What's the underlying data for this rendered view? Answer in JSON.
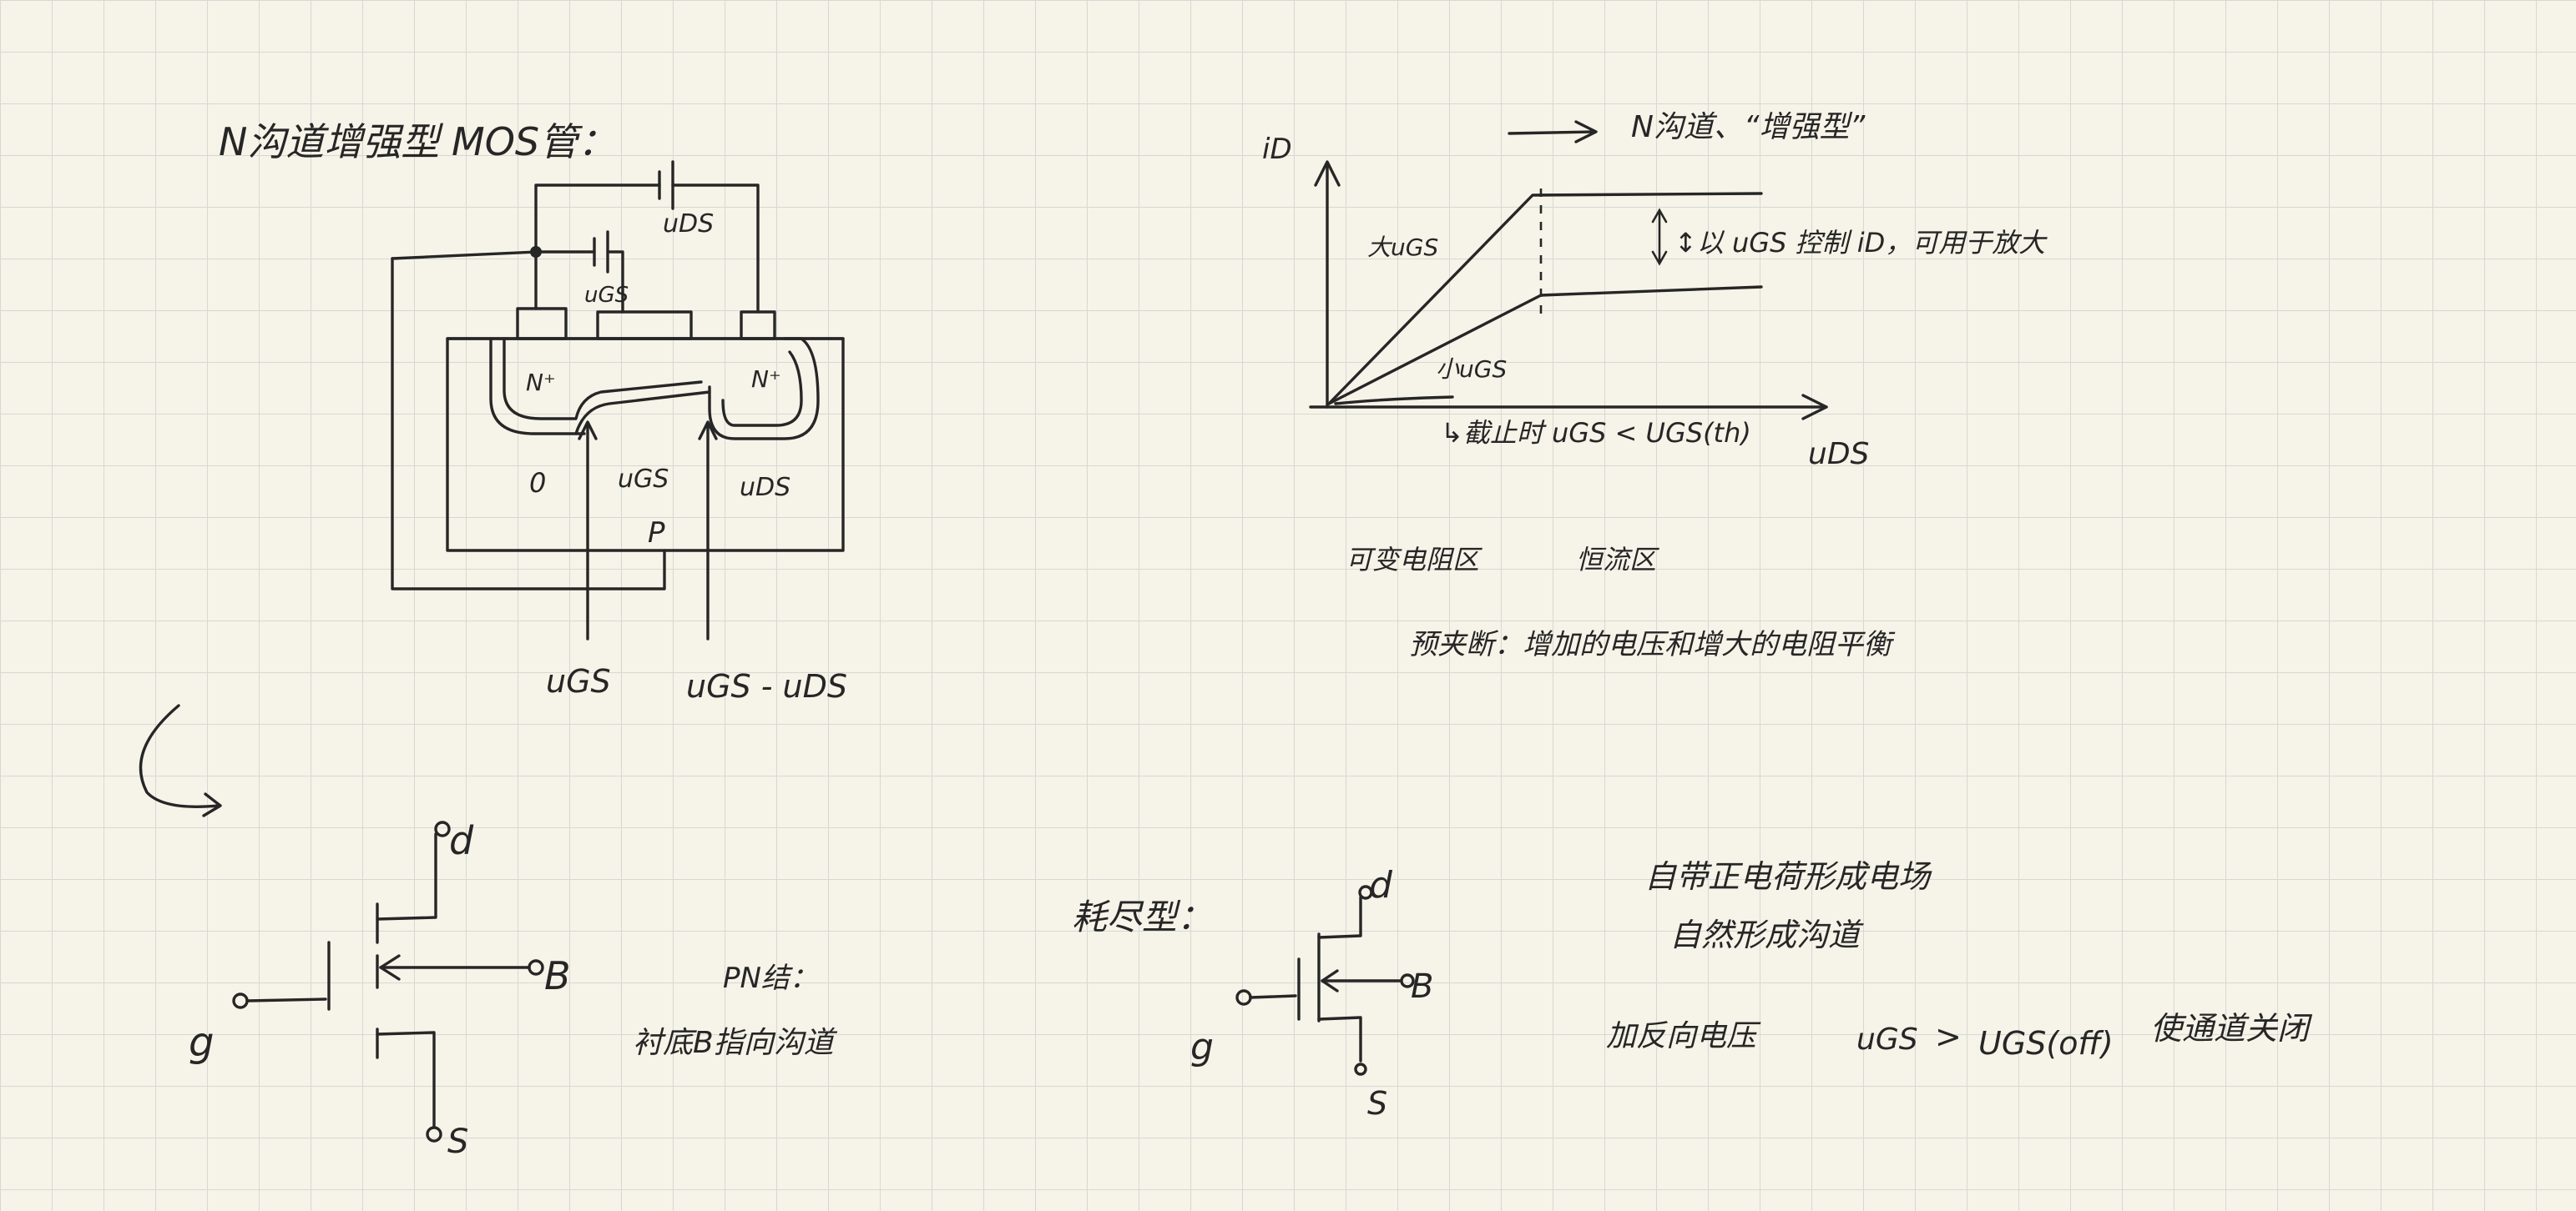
{
  "page": {
    "title": "N沟道增强型 MOS管："
  },
  "cross_section": {
    "labels": {
      "uds_top": "uDS",
      "ugs_top": "uGS",
      "n_left": "N⁺",
      "n_right": "N⁺",
      "zero": "0",
      "ugs_mid": "uGS",
      "uds_mid": "uDS",
      "p_substrate": "P",
      "ugs_bottom": "uGS",
      "ugs_minus_uds": "uGS - uDS"
    }
  },
  "characteristic": {
    "label_id": "iD",
    "arrow_note": "N沟道、“增强型”",
    "curve_large": "大uGS",
    "curve_small": "小uGS",
    "control_note": "↕以 uGS 控制 iD，可用于放大",
    "cutoff_note": "↳截止时 uGS < UGS(th)",
    "label_uds": "uDS",
    "region_variable": "可变电阻区",
    "region_constant": "恒流区",
    "pinchoff_note": "预夹断：增加的电压和增大的电阻平衡"
  },
  "enh_symbol": {
    "d": "d",
    "g": "g",
    "b": "B",
    "s": "S",
    "pn_note": "PN结：",
    "sub_note": "衬底B指向沟道"
  },
  "dep_symbol": {
    "title": "耗尽型：",
    "d": "d",
    "g": "g",
    "b": "B",
    "s": "S",
    "note1": "自带正电荷形成电场",
    "note2": "自然形成沟道",
    "note3_prefix": "加反向电压",
    "note3_ugs": "uGS",
    "note3_gt": ">",
    "note3_uoff": "UGS(off)",
    "note3_suffix": "使通道关闭"
  }
}
